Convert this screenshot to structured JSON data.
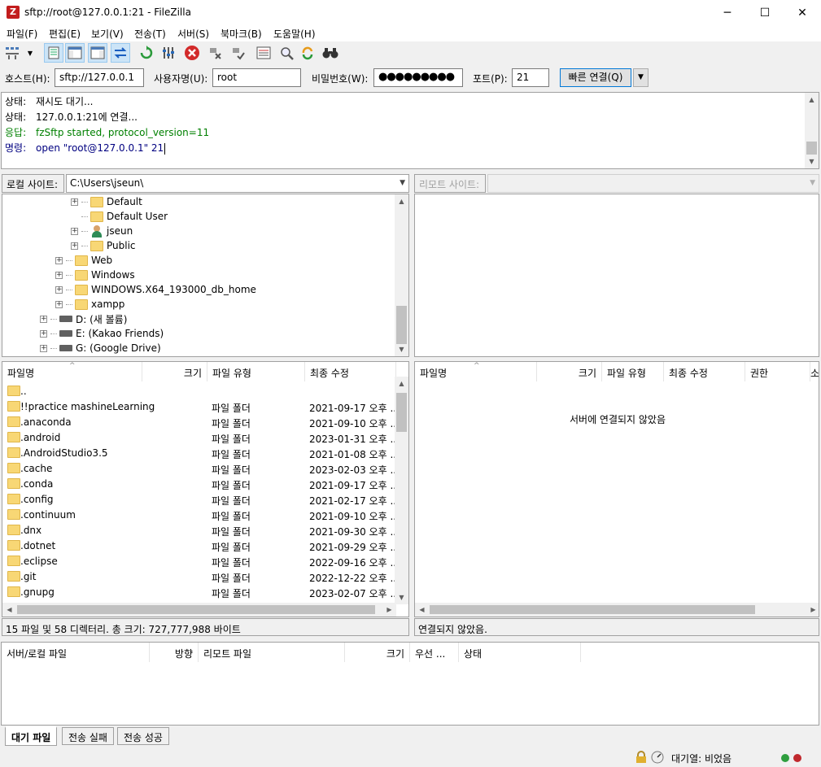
{
  "window": {
    "title": "sftp://root@127.0.0.1:21 - FileZilla",
    "app_icon": "filezilla-icon",
    "controls": {
      "minimize": "─",
      "maximize": "☐",
      "close": "✕"
    }
  },
  "menu": [
    "파일(F)",
    "편집(E)",
    "보기(V)",
    "전송(T)",
    "서버(S)",
    "북마크(B)",
    "도움말(H)"
  ],
  "quickconnect": {
    "host_label": "호스트(H):",
    "host_value": "sftp://127.0.0.1",
    "user_label": "사용자명(U):",
    "user_value": "root",
    "pass_label": "비밀번호(W):",
    "pass_value": "●●●●●●●●●",
    "port_label": "포트(P):",
    "port_value": "21",
    "connect_label": "빠른 연결(Q)"
  },
  "log": [
    {
      "key": "상태:",
      "text": "재시도 대기...",
      "color": "#000000"
    },
    {
      "key": "상태:",
      "text": "127.0.0.1:21에 연결...",
      "color": "#000000"
    },
    {
      "key": "응답:",
      "text": "fzSftp started, protocol_version=11",
      "color": "#008000"
    },
    {
      "key": "명령:",
      "text": "open \"root@127.0.0.1\" 21",
      "color": "#000080"
    }
  ],
  "local": {
    "site_label": "로컬 사이트:",
    "path": "C:\\Users\\jseun\\",
    "tree": [
      {
        "label": "Default",
        "icon": "folder-icon"
      },
      {
        "label": "Default User",
        "icon": "folder-icon"
      },
      {
        "label": "jseun",
        "icon": "user-folder-icon"
      },
      {
        "label": "Public",
        "icon": "folder-icon"
      },
      {
        "label": "Web",
        "icon": "folder-icon"
      },
      {
        "label": "Windows",
        "icon": "folder-icon"
      },
      {
        "label": "WINDOWS.X64_193000_db_home",
        "icon": "folder-icon"
      },
      {
        "label": "xampp",
        "icon": "folder-icon"
      },
      {
        "label": "D: (새 볼륨)",
        "icon": "drive-icon"
      },
      {
        "label": "E: (Kakao Friends)",
        "icon": "drive-icon"
      },
      {
        "label": "G: (Google Drive)",
        "icon": "drive-icon"
      }
    ],
    "columns": [
      "파일명",
      "크기",
      "파일 유형",
      "최종 수정"
    ],
    "files": [
      {
        "name": "..",
        "type": "",
        "modified": ""
      },
      {
        "name": "!!practice mashineLearning",
        "type": "파일 폴더",
        "modified": "2021-09-17 오후 ..."
      },
      {
        "name": ".anaconda",
        "type": "파일 폴더",
        "modified": "2021-09-10 오후 ..."
      },
      {
        "name": ".android",
        "type": "파일 폴더",
        "modified": "2023-01-31 오후 ..."
      },
      {
        "name": ".AndroidStudio3.5",
        "type": "파일 폴더",
        "modified": "2021-01-08 오후 ..."
      },
      {
        "name": ".cache",
        "type": "파일 폴더",
        "modified": "2023-02-03 오후 ..."
      },
      {
        "name": ".conda",
        "type": "파일 폴더",
        "modified": "2021-09-17 오후 ..."
      },
      {
        "name": ".config",
        "type": "파일 폴더",
        "modified": "2021-02-17 오후 ..."
      },
      {
        "name": ".continuum",
        "type": "파일 폴더",
        "modified": "2021-09-10 오후 ..."
      },
      {
        "name": ".dnx",
        "type": "파일 폴더",
        "modified": "2021-09-30 오후 ..."
      },
      {
        "name": ".dotnet",
        "type": "파일 폴더",
        "modified": "2021-09-29 오후 ..."
      },
      {
        "name": ".eclipse",
        "type": "파일 폴더",
        "modified": "2022-09-16 오후 ..."
      },
      {
        "name": ".git",
        "type": "파일 폴더",
        "modified": "2022-12-22 오후 ..."
      },
      {
        "name": ".gnupg",
        "type": "파일 폴더",
        "modified": "2023-02-07 오후 ..."
      }
    ],
    "status": "15 파일 및 58 디렉터리. 총 크기: 727,777,988 바이트"
  },
  "remote": {
    "site_label": "리모트 사이트:",
    "columns": [
      "파일명",
      "크기",
      "파일 유형",
      "최종 수정",
      "권한",
      "소"
    ],
    "empty_message": "서버에 연결되지 않았음",
    "status": "연결되지 않았음."
  },
  "queue": {
    "columns": [
      "서버/로컬 파일",
      "방향",
      "리모트 파일",
      "크기",
      "우선 ...",
      "상태"
    ],
    "tabs": [
      "대기 파일",
      "전송 실패",
      "전송 성공"
    ]
  },
  "statusbar": {
    "queue_text": "대기열: 비었음"
  },
  "colors": {
    "accent": "#0078d7",
    "log_response": "#008000",
    "log_command": "#000080",
    "led_green": "#2e9e3e",
    "led_red": "#c0282d"
  }
}
